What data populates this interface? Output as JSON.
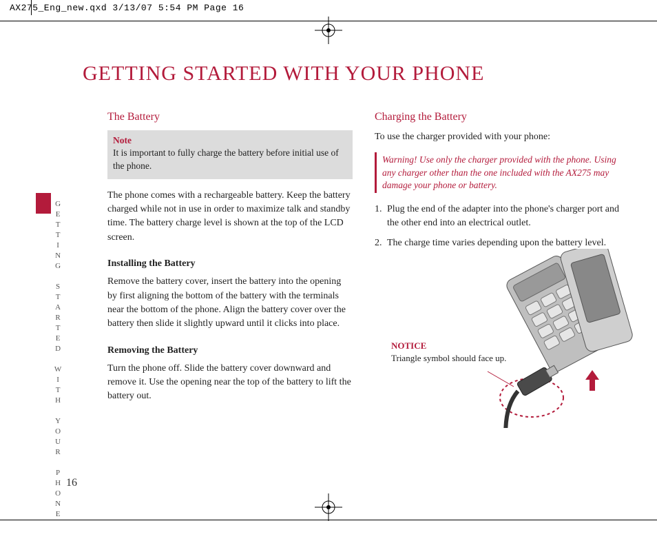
{
  "slug": "AX275_Eng_new.qxd  3/13/07  5:54 PM  Page 16",
  "page_title": "GETTING STARTED WITH YOUR PHONE",
  "side_label": "GETTING STARTED WITH YOUR PHONE",
  "page_number": "16",
  "left": {
    "section_head": "The Battery",
    "note_label": "Note",
    "note_body": "It is important to fully charge the battery before initial use of the phone.",
    "intro": "The phone comes with a rechargeable battery. Keep the battery charged while not in use in order to maximize talk and standby time. The battery charge level is shown at the top of the LCD screen.",
    "sub1_head": "Installing the Battery",
    "sub1_body": "Remove the battery cover, insert the battery into the opening by first aligning the bottom of the battery with the terminals near the bottom of the phone. Align the battery cover over the battery then slide it slightly upward until it clicks into place.",
    "sub2_head": "Removing the Battery",
    "sub2_body": "Turn the phone off. Slide the battery cover downward and remove it. Use the opening near the top of the battery to lift the battery out."
  },
  "right": {
    "section_head": "Charging the Battery",
    "intro": "To use the charger provided with your phone:",
    "warning": "Warning! Use only the charger provided with the phone. Using any charger other than the one included with the AX275 may damage your phone or battery.",
    "step1_num": "1.",
    "step1": "Plug the end of the adapter into the phone's charger port and the other end into an electrical outlet.",
    "step2_num": "2.",
    "step2": "The charge time varies depending upon the battery level.",
    "notice_label": "NOTICE",
    "notice_body": "Triangle symbol should face up."
  }
}
